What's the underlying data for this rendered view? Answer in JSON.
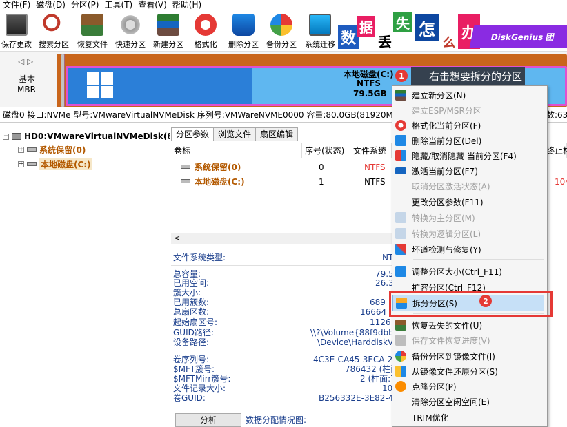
{
  "menu": [
    "文件(F)",
    "磁盘(D)",
    "分区(P)",
    "工具(T)",
    "查看(V)",
    "帮助(H)"
  ],
  "toolbar": [
    {
      "label": "保存更改",
      "icon": "save-icon"
    },
    {
      "label": "搜索分区",
      "icon": "search-icon"
    },
    {
      "label": "恢复文件",
      "icon": "recover-file-icon"
    },
    {
      "label": "快速分区",
      "icon": "quick-partition-icon"
    },
    {
      "label": "新建分区",
      "icon": "new-partition-icon"
    },
    {
      "label": "格式化",
      "icon": "format-icon"
    },
    {
      "label": "删除分区",
      "icon": "delete-partition-icon"
    },
    {
      "label": "备份分区",
      "icon": "backup-icon"
    },
    {
      "label": "系统迁移",
      "icon": "migrate-icon"
    }
  ],
  "banner": {
    "chars": [
      "数",
      "据",
      "丢",
      "失",
      "怎",
      "么",
      "办"
    ],
    "brand": "DiskGenius 团"
  },
  "disk_strip": {
    "type": "基本",
    "scheme": "MBR",
    "partition_name": "本地磁盘(C:)",
    "fs": "NTFS",
    "size": "79.5GB"
  },
  "callout": {
    "text": "右击想要拆分的分区",
    "badge1": "1",
    "badge2": "2"
  },
  "disk_info": "磁盘0 接口:NVMe  型号:VMwareVirtualNVMeDisk  序列号:VMWareNVME0000  容量:80.0GB(81920M",
  "disk_info_tail": "数:63",
  "tree": {
    "root": "HD0:VMwareVirtualNVMeDisk(8",
    "children": [
      "系统保留(0)",
      "本地磁盘(C:)"
    ]
  },
  "tabs": [
    "分区参数",
    "浏览文件",
    "扇区编辑"
  ],
  "table": {
    "headers": [
      "卷标",
      "序号(状态)",
      "文件系统",
      "终止柱"
    ],
    "rows": [
      {
        "name": "系统保留(0)",
        "index": "0",
        "fs": "NTFS",
        "end": ""
      },
      {
        "name": "本地磁盘(C:)",
        "index": "1",
        "fs": "NTFS",
        "end": "104"
      }
    ]
  },
  "details": {
    "fs_type_label": "文件系统类型:",
    "fs_type_value": "NT",
    "group1": [
      {
        "label": "总容量:",
        "value": "79.5"
      },
      {
        "label": "已用空间:",
        "value": "26.3"
      },
      {
        "label": "簇大小:",
        "value": ""
      },
      {
        "label": "已用簇数:",
        "value": "689"
      },
      {
        "label": "总扇区数:",
        "value": "16664"
      },
      {
        "label": "起始扇区号:",
        "value": "1126"
      },
      {
        "label": "GUID路径:",
        "value": "\\\\?\\Volume{88f9dbb"
      },
      {
        "label": "设备路径:",
        "value": "\\Device\\HarddiskV"
      }
    ],
    "group2": [
      {
        "label": "卷序列号:",
        "value": "4C3E-CA45-3ECA-28"
      },
      {
        "label": "$MFT簇号:",
        "value": "786432 (柱面"
      },
      {
        "label": "$MFTMirr簇号:",
        "value": "2 (柱面:7"
      },
      {
        "label": "文件记录大小:",
        "value": "10"
      },
      {
        "label": "卷GUID:",
        "value": "B256332E-3E82-4F"
      }
    ],
    "analyze_button": "分析",
    "alloc_label": "数据分配情况图:"
  },
  "context_menu": [
    {
      "label": "建立新分区(N)",
      "disabled": false,
      "icon": "new-partition-icon"
    },
    {
      "label": "建立ESP/MSR分区",
      "disabled": true,
      "icon": ""
    },
    {
      "label": "格式化当前分区(F)",
      "disabled": false,
      "icon": "format-icon"
    },
    {
      "label": "删除当前分区(Del)",
      "disabled": false,
      "icon": "delete-icon"
    },
    {
      "label": "隐藏/取消隐藏 当前分区(F4)",
      "disabled": false,
      "icon": "hide-icon"
    },
    {
      "label": "激活当前分区(F7)",
      "disabled": false,
      "icon": "activate-icon"
    },
    {
      "label": "取消分区激活状态(A)",
      "disabled": true,
      "icon": ""
    },
    {
      "label": "更改分区参数(F11)",
      "disabled": false,
      "icon": ""
    },
    {
      "label": "转换为主分区(M)",
      "disabled": true,
      "icon": "convert-primary-icon"
    },
    {
      "label": "转换为逻辑分区(L)",
      "disabled": true,
      "icon": "convert-logical-icon"
    },
    {
      "label": "坏道检测与修复(Y)",
      "disabled": false,
      "icon": "tools-icon"
    },
    {
      "label": "调整分区大小(Ctrl_F11)",
      "disabled": false,
      "icon": "resize-icon"
    },
    {
      "label": "扩容分区(Ctrl_F12)",
      "disabled": false,
      "icon": ""
    },
    {
      "label": "拆分分区(S)",
      "disabled": false,
      "icon": "split-icon"
    },
    {
      "label": "恢复丢失的文件(U)",
      "disabled": false,
      "icon": "recover-file-icon"
    },
    {
      "label": "保存文件恢复进度(V)",
      "disabled": true,
      "icon": "save-progress-icon"
    },
    {
      "label": "备份分区到镜像文件(I)",
      "disabled": false,
      "icon": "backup-icon"
    },
    {
      "label": "从镜像文件还原分区(S)",
      "disabled": false,
      "icon": "restore-icon"
    },
    {
      "label": "克隆分区(P)",
      "disabled": false,
      "icon": "clone-icon"
    },
    {
      "label": "清除分区空闲空间(E)",
      "disabled": false,
      "icon": ""
    },
    {
      "label": "TRIM优化",
      "disabled": false,
      "icon": ""
    }
  ]
}
